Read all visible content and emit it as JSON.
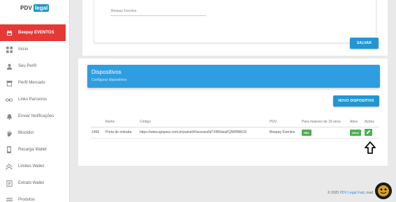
{
  "brand": {
    "part1": "PDV",
    "part2": "legal"
  },
  "sidebar": {
    "items": [
      {
        "label": "Beepay EVENTOS",
        "icon": "event-icon",
        "active": true
      },
      {
        "label": "Início",
        "icon": "dashboard-icon"
      },
      {
        "label": "Seu Perfil",
        "icon": "user-icon"
      },
      {
        "label": "Perfil Mercado",
        "icon": "store-icon"
      },
      {
        "label": "Links Parceiros",
        "icon": "link-icon"
      },
      {
        "label": "Enviar Notificações",
        "icon": "bell-icon"
      },
      {
        "label": "Blocklist",
        "icon": "hand-icon"
      },
      {
        "label": "Recarga Wallet",
        "icon": "phone-icon"
      },
      {
        "label": "Limites Wallet",
        "icon": "limits-icon"
      },
      {
        "label": "Extrato Wallet",
        "icon": "receipt-icon"
      },
      {
        "label": "Produtos",
        "icon": "list-icon"
      }
    ]
  },
  "event_card": {
    "event_value": "Beepay Eventos",
    "save_label": "SALVAR"
  },
  "devices": {
    "title": "Dispositivos",
    "subtitle": "Configurar dispositivos",
    "new_label": "NOVO DISPOSITIVO",
    "columns": [
      "Nome",
      "Código",
      "PDV",
      "Para maiores de 18 anos",
      "Ativo",
      "Ações"
    ],
    "rows": [
      {
        "id": "1466",
        "nome": "Porta de entrada",
        "codigo": "https://www.igopass.com.br/painel/#/acesso/lqTXRRduqFQWRBKfJ3",
        "pdv": "Beepay Eventos",
        "maiores": "Não",
        "ativo": "Ativo"
      }
    ]
  },
  "footer": {
    "prefix": "© 2025 ",
    "link": "PDV Legal Fast",
    "suffix": ", mad"
  },
  "colors": {
    "accent_red": "#e53935",
    "primary_blue": "#2196d3",
    "banner_blue": "#2e9ee0",
    "success_green": "#4caf50"
  }
}
